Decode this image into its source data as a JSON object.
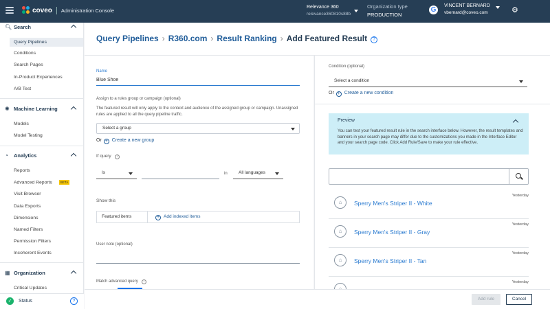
{
  "topbar": {
    "brand": "coveo",
    "console": "Administration Console",
    "org_name": "Relevance 360",
    "org_id": "relevance360810s88b",
    "org_type_label": "Organization type",
    "org_type_value": "PRODUCTION",
    "user_name": "VINCENT BERNARD",
    "user_email": "vbernard@coveo.com"
  },
  "sidebar": {
    "sections": [
      {
        "label": "Search",
        "items": [
          "Query Pipelines",
          "Conditions",
          "Search Pages",
          "In-Product Experiences",
          "A/B Test"
        ]
      },
      {
        "label": "Machine Learning",
        "items": [
          "Models",
          "Model Testing"
        ]
      },
      {
        "label": "Analytics",
        "items": [
          "Reports",
          "Advanced Reports",
          "Visit Browser",
          "Data Exports",
          "Dimensions",
          "Named Filters",
          "Permission Filters",
          "Incoherent Events"
        ]
      },
      {
        "label": "Organization",
        "items": [
          "Critical Updates"
        ]
      }
    ],
    "beta": "BETA",
    "status": "Status"
  },
  "breadcrumb": {
    "c1": "Query Pipelines",
    "c2": "R360.com",
    "c3": "Result Ranking",
    "current": "Add Featured Result"
  },
  "form": {
    "name_label": "Name",
    "name_value": "Blue Shoe",
    "assign_label": "Assign to a rules group or campaign (optional)",
    "assign_help": "The featured result will only apply to the context and audience of the assigned group or campaign. Unassigned rules are applied to all the query pipeline traffic.",
    "select_group": "Select a group",
    "or": "Or",
    "create_group": "Create a new group",
    "if_query": "If query",
    "operator": "Is",
    "in": "in",
    "language": "All languages",
    "show_this": "Show this",
    "featured_items": "Featured items",
    "add_indexed": "Add indexed items",
    "user_note": "User note (optional)",
    "match_advanced": "Match advanced query"
  },
  "condition": {
    "label": "Condition (optional)",
    "select": "Select a condition",
    "or": "Or",
    "create": "Create a new condition"
  },
  "preview": {
    "title": "Preview",
    "text": "You can test your featured result rule in the search interface below. However, the result templates and banners in your search page may differ due to the customizations you made in the Interface Editor and your search page code. Click Add Rule/Save to make your rule effective."
  },
  "results": [
    {
      "title": "Sperry Men's Striper II - White",
      "time": "Yesterday"
    },
    {
      "title": "Sperry Men's Striper II - Gray",
      "time": "Yesterday"
    },
    {
      "title": "Sperry Men's Striper II - Tan",
      "time": "Yesterday"
    },
    {
      "title": "",
      "time": "Yesterday"
    }
  ],
  "footer": {
    "add_rule": "Add rule",
    "cancel": "Cancel"
  }
}
